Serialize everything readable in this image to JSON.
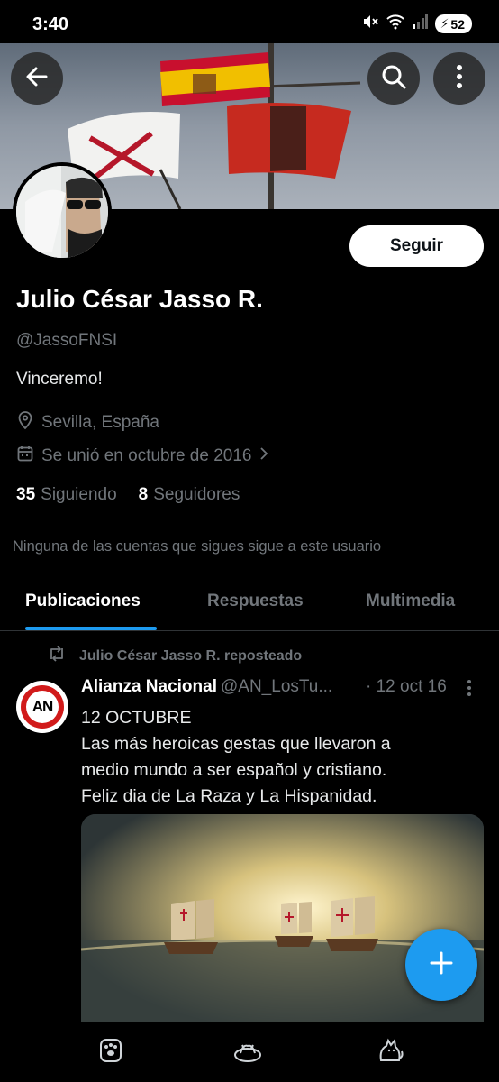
{
  "status_bar": {
    "time": "3:40",
    "battery": "52"
  },
  "profile": {
    "follow_label": "Seguir",
    "display_name": "Julio César Jasso R.",
    "handle": "@JassoFNSI",
    "bio": "Vinceremo!",
    "location": "Sevilla, España",
    "joined": "Se unió en octubre de 2016",
    "following_count": "35",
    "following_label": "Siguiendo",
    "followers_count": "8",
    "followers_label": "Seguidores",
    "mutuals_note": "Ninguna de las cuentas que sigues sigue a este usuario"
  },
  "tabs": [
    {
      "label": "Publicaciones",
      "active": true
    },
    {
      "label": "Respuestas",
      "active": false
    },
    {
      "label": "Multimedia",
      "active": false
    }
  ],
  "post": {
    "repost_label": "Julio César Jasso R. reposteado",
    "avatar_text": "AN",
    "author": "Alianza Nacional",
    "handle": "@AN_LosTu...",
    "date": "· 12 oct 16",
    "text_lines": [
      "12 OCTUBRE",
      "Las más heroicas gestas que llevaron a",
      "medio mundo a ser español y cristiano.",
      "Feliz dia de La Raza y La Hispanidad."
    ]
  },
  "icons": {
    "back": "arrow-left-icon",
    "search": "search-icon",
    "more": "more-vertical-icon",
    "location": "location-pin-icon",
    "calendar": "calendar-icon",
    "repost": "repost-icon",
    "compose": "plus-icon"
  },
  "colors": {
    "accent": "#1d9bf0",
    "background": "#000000",
    "muted": "#71767b"
  }
}
